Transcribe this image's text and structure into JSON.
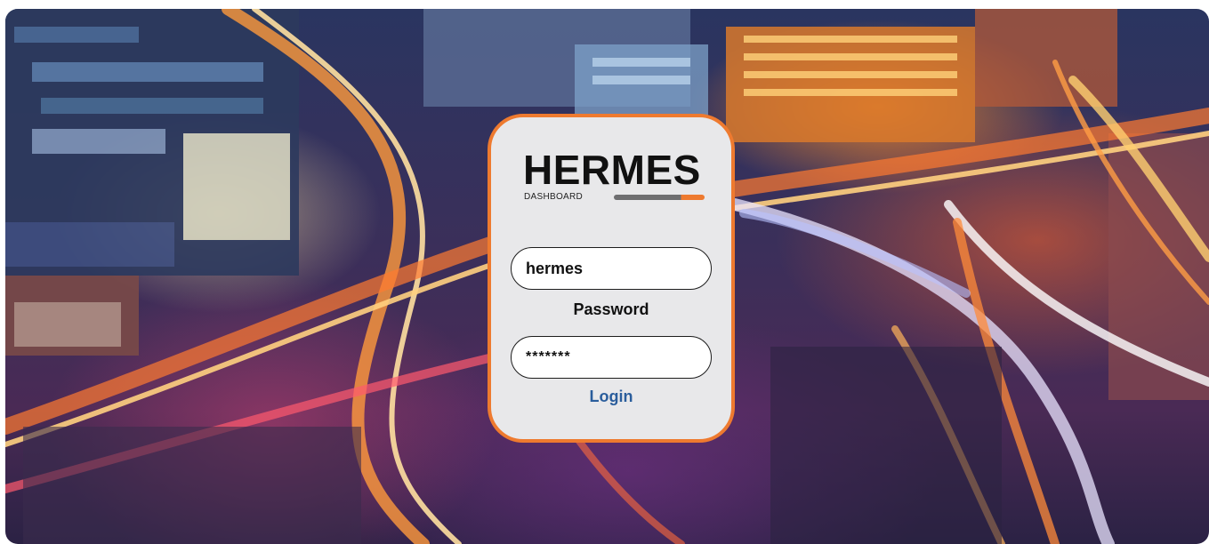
{
  "background": {
    "description_icon": "city-highway-night-photo"
  },
  "brand": {
    "title": "HERMES",
    "subtitle": "DASHBOARD",
    "accent_color": "#ee7a2f",
    "bar_color": "#6e6e70"
  },
  "login": {
    "username_value": "hermes",
    "password_label": "Password",
    "password_value": "*******",
    "login_label": "Login",
    "card_border_color": "#ee7a2f",
    "card_background": "#e8e8ea",
    "login_color": "#2a5d9c"
  }
}
